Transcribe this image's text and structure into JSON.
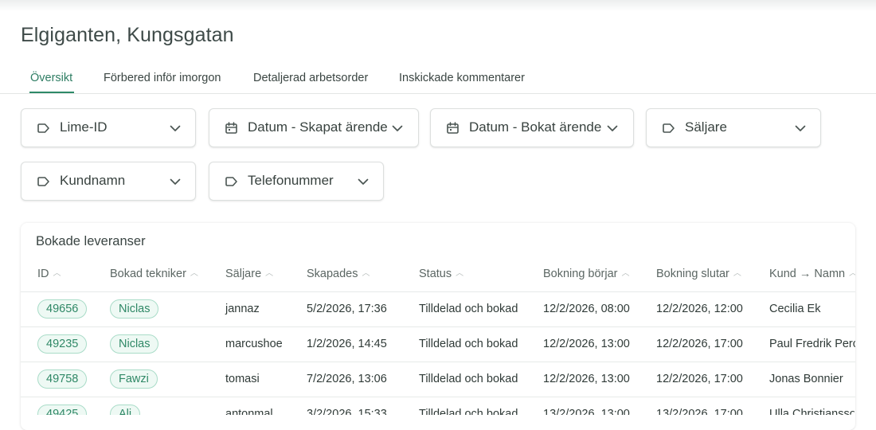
{
  "page": {
    "title": "Elgiganten, Kungsgatan"
  },
  "tabs": [
    {
      "label": "Översikt",
      "active": true
    },
    {
      "label": "Förbered inför imorgon",
      "active": false
    },
    {
      "label": "Detaljerad arbetsorder",
      "active": false
    },
    {
      "label": "Inskickade kommentarer",
      "active": false
    }
  ],
  "filters": [
    {
      "label": "Lime-ID",
      "icon": "tag-icon"
    },
    {
      "label": "Datum - Skapat ärende",
      "icon": "calendar-icon"
    },
    {
      "label": "Datum - Bokat ärende",
      "icon": "calendar-icon"
    },
    {
      "label": "Säljare",
      "icon": "tag-icon"
    },
    {
      "label": "Kundnamn",
      "icon": "tag-icon"
    },
    {
      "label": "Telefonummer",
      "icon": "tag-icon"
    }
  ],
  "table": {
    "title": "Bokade leveranser",
    "columns": [
      "ID",
      "Bokad tekniker",
      "Säljare",
      "Skapades",
      "Status",
      "Bokning börjar",
      "Bokning slutar",
      "Kund → Namn"
    ],
    "rows": [
      [
        "49656",
        "Niclas",
        "jannaz",
        "5/2/2026, 17:36",
        "Tilldelad och bokad",
        "12/2/2026, 08:00",
        "12/2/2026, 12:00",
        "Cecilia Ek"
      ],
      [
        "49235",
        "Niclas",
        "marcushoe",
        "1/2/2026, 14:45",
        "Tilldelad och bokad",
        "12/2/2026, 13:00",
        "12/2/2026, 17:00",
        "Paul Fredrik Perc"
      ],
      [
        "49758",
        "Fawzi",
        "tomasi",
        "7/2/2026, 13:06",
        "Tilldelad och bokad",
        "12/2/2026, 13:00",
        "12/2/2026, 17:00",
        "Jonas Bonnier"
      ],
      [
        "49425",
        "Ali",
        "antonmal",
        "3/2/2026, 15:33",
        "Tilldelad och bokad",
        "13/2/2026, 13:00",
        "13/2/2026, 17:00",
        "Ulla Christiansso"
      ]
    ]
  },
  "colors": {
    "accent": "#2e8a68",
    "pill_bg": "#eef9f4",
    "pill_border": "#a9dcc8"
  }
}
